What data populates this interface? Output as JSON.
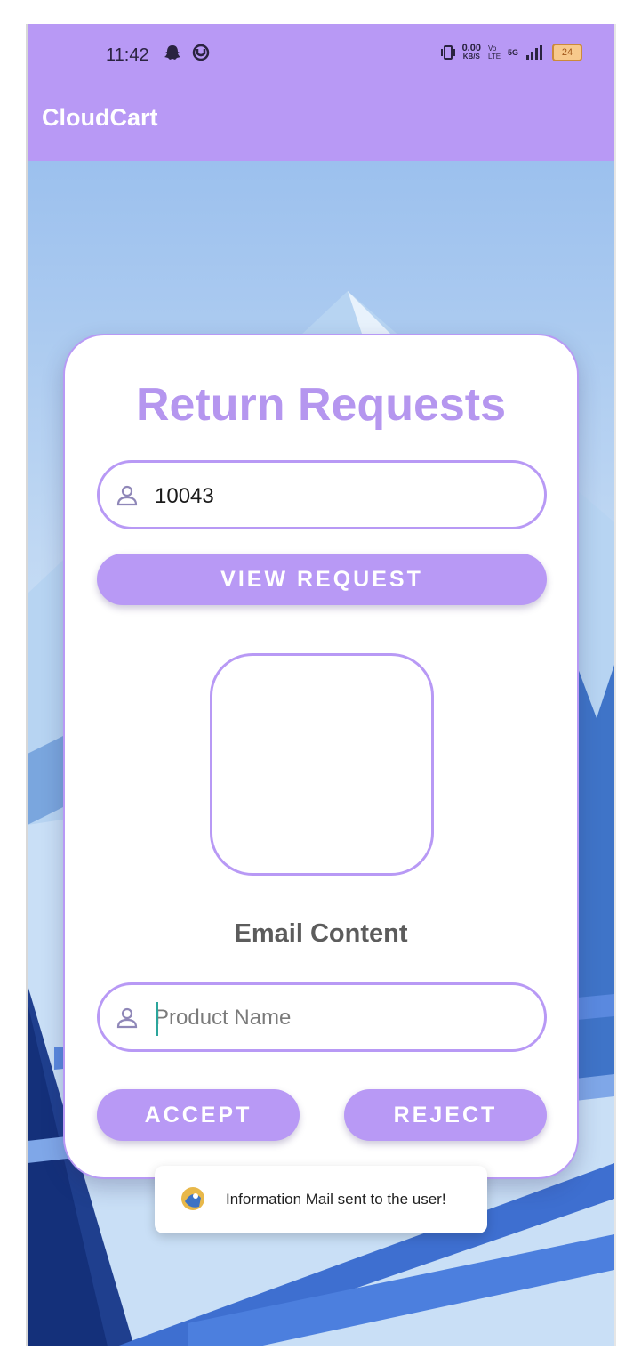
{
  "status_bar": {
    "time": "11:42",
    "left_icons": [
      "snapchat-icon",
      "app-notification-icon"
    ],
    "right_icons": [
      "vibrate-icon",
      "volte-icon",
      "signal-icon"
    ],
    "data_speed_value": "0.00",
    "data_speed_unit": "KB/S",
    "network_label": "Vo LTE",
    "network_gen": "5G",
    "battery": "24"
  },
  "app_bar": {
    "title": "CloudCart"
  },
  "card": {
    "title": "Return Requests",
    "request_field": {
      "icon": "person-icon",
      "value": "10043"
    },
    "view_button": "VIEW REQUEST",
    "email_content_label": "Email Content",
    "product_field": {
      "icon": "person-icon",
      "placeholder": "Product Name"
    },
    "accept_button": "ACCEPT",
    "reject_button": "REJECT"
  },
  "toast": {
    "icon": "app-icon",
    "message": "Information Mail sent to the user!"
  },
  "colors": {
    "primary": "#b899f5",
    "title": "#b596ef",
    "background_sky": "#9cc3f0"
  }
}
